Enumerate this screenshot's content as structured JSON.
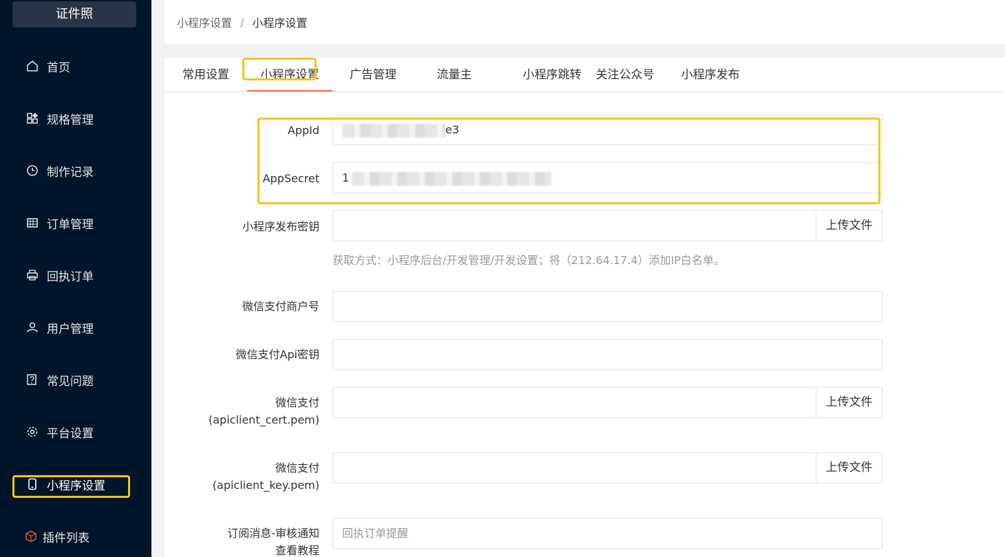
{
  "sidebar": {
    "logo": "证件照",
    "items": [
      {
        "label": "首页",
        "icon": "home-icon"
      },
      {
        "label": "规格管理",
        "icon": "grid-icon"
      },
      {
        "label": "制作记录",
        "icon": "clock-icon"
      },
      {
        "label": "订单管理",
        "icon": "table-icon"
      },
      {
        "label": "回执订单",
        "icon": "printer-icon"
      },
      {
        "label": "用户管理",
        "icon": "user-icon"
      },
      {
        "label": "常见问题",
        "icon": "question-icon"
      },
      {
        "label": "平台设置",
        "icon": "gear-icon"
      },
      {
        "label": "小程序设置",
        "icon": "phone-icon"
      },
      {
        "label": "插件列表",
        "icon": "cube-icon"
      }
    ],
    "accent_color": "#f5c518"
  },
  "breadcrumb": {
    "parent": "小程序设置",
    "separator": "/",
    "current": "小程序设置"
  },
  "tabs": [
    {
      "label": "常用设置"
    },
    {
      "label": "小程序设置"
    },
    {
      "label": "广告管理"
    },
    {
      "label": "流量主"
    },
    {
      "label": "小程序跳转"
    },
    {
      "label": "关注公众号"
    },
    {
      "label": "小程序发布"
    }
  ],
  "tab_active_color": "#ff6a3a",
  "form": {
    "appid": {
      "label": "AppId",
      "value_suffix": "e3"
    },
    "appsecret": {
      "label": "AppSecret",
      "value_prefix": "1"
    },
    "publish_key": {
      "label": "小程序发布密钥",
      "button": "上传文件",
      "hint": "获取方式：小程序后台/开发管理/开发设置；将（212.64.17.4）添加IP白名单。"
    },
    "mch_id": {
      "label": "微信支付商户号"
    },
    "api_key": {
      "label": "微信支付Api密钥"
    },
    "cert": {
      "label_line1": "微信支付",
      "label_line2": "(apiclient_cert.pem)",
      "button": "上传文件"
    },
    "key": {
      "label_line1": "微信支付",
      "label_line2": "(apiclient_key.pem)",
      "button": "上传文件"
    },
    "subscribe": {
      "label_line1": "订阅消息-审核通知",
      "label_line2": "查看教程",
      "placeholder": "回执订单提醒"
    }
  }
}
